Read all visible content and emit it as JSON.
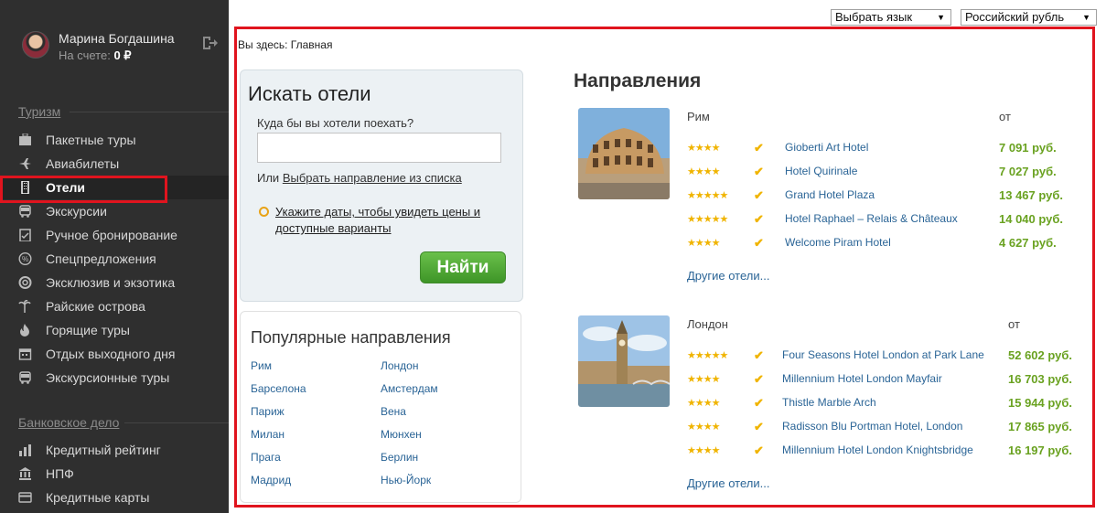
{
  "user": {
    "name": "Марина Богдашина",
    "balance_label": "На счете:",
    "balance_value": "0 ₽"
  },
  "sidebar": {
    "sections": [
      {
        "title": "Туризм",
        "items": [
          {
            "label": "Пакетные туры",
            "icon": "suitcase-icon"
          },
          {
            "label": "Авиабилеты",
            "icon": "plane-icon"
          },
          {
            "label": "Отели",
            "icon": "building-icon",
            "active": true
          },
          {
            "label": "Экскурсии",
            "icon": "bus-icon"
          },
          {
            "label": "Ручное бронирование",
            "icon": "clipboard-check-icon"
          },
          {
            "label": "Спецпредложения",
            "icon": "percent-icon"
          },
          {
            "label": "Эксклюзив и экзотика",
            "icon": "lifebuoy-icon"
          },
          {
            "label": "Райские острова",
            "icon": "palm-icon"
          },
          {
            "label": "Горящие туры",
            "icon": "fire-icon"
          },
          {
            "label": "Отдых выходного дня",
            "icon": "calendar-icon"
          },
          {
            "label": "Экскурсионные туры",
            "icon": "bus-icon"
          }
        ]
      },
      {
        "title": "Банковское дело",
        "items": [
          {
            "label": "Кредитный рейтинг",
            "icon": "chart-icon"
          },
          {
            "label": "НПФ",
            "icon": "bank-icon"
          },
          {
            "label": "Кредитные карты",
            "icon": "credit-card-icon"
          }
        ]
      }
    ]
  },
  "top": {
    "language_select": "Выбрать язык",
    "currency_select": "Российский рубль"
  },
  "breadcrumb": "Вы здесь: Главная",
  "search": {
    "title": "Искать отели",
    "question": "Куда бы вы хотели поехать?",
    "input_value": "",
    "or_prefix": "Или",
    "or_link": "Выбрать направление из списка",
    "hint_line1": "Укажите даты, чтобы увидеть цены и",
    "hint_line2": "доступные варианты",
    "button": "Найти"
  },
  "popular": {
    "title": "Популярные направления",
    "left": [
      "Рим",
      "Барселона",
      "Париж",
      "Милан",
      "Прага",
      "Мадрид"
    ],
    "right": [
      "Лондон",
      "Амстердам",
      "Вена",
      "Мюнхен",
      "Берлин",
      "Нью-Йорк"
    ]
  },
  "destinations": {
    "heading": "Направления",
    "items": [
      {
        "city": "Рим",
        "from_label": "от",
        "more": "Другие отели...",
        "hotels": [
          {
            "name": "Gioberti Art Hotel",
            "stars": 4,
            "price": "7 091 руб."
          },
          {
            "name": "Hotel Quirinale",
            "stars": 4,
            "price": "7 027 руб."
          },
          {
            "name": "Grand Hotel Plaza",
            "stars": 5,
            "price": "13 467 руб."
          },
          {
            "name": "Hotel Raphael – Relais & Châteaux",
            "stars": 5,
            "price": "14 040 руб."
          },
          {
            "name": "Welcome Piram Hotel",
            "stars": 4,
            "price": "4 627 руб."
          }
        ]
      },
      {
        "city": "Лондон",
        "from_label": "от",
        "more": "Другие отели...",
        "hotels": [
          {
            "name": "Four Seasons Hotel London at Park Lane",
            "stars": 5,
            "price": "52 602 руб."
          },
          {
            "name": "Millennium Hotel London Mayfair",
            "stars": 4,
            "price": "16 703 руб."
          },
          {
            "name": "Thistle Marble Arch",
            "stars": 4,
            "price": "15 944 руб."
          },
          {
            "name": "Radisson Blu Portman Hotel, London",
            "stars": 4,
            "price": "17 865 руб."
          },
          {
            "name": "Millennium Hotel London Knightsbridge",
            "stars": 4,
            "price": "16 197 руб."
          }
        ]
      }
    ]
  }
}
